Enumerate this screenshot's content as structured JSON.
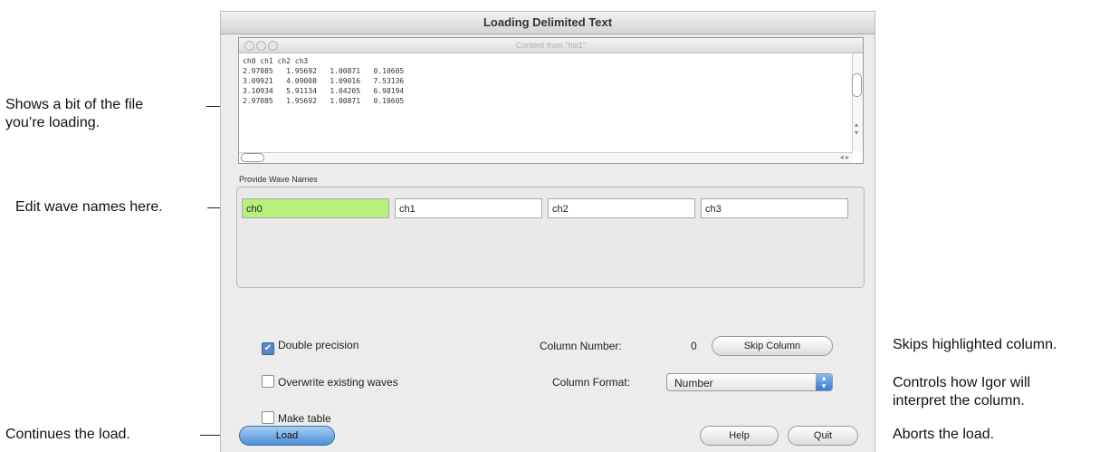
{
  "dialog": {
    "title": "Loading Delimited Text",
    "preview_title": "Content from \"hsi1\"",
    "preview_lines": [
      "ch0 ch1 ch2 ch3",
      "2.97085   1.95692   1.00871   0.10605",
      "3.09921   4.09008   1.09016   7.53136",
      "3.10934   5.91134   1.04205   6.98194",
      "2.97085   1.95692   1.00871   0.10605"
    ],
    "wave_group_label": "Provide Wave Names",
    "wave_names": [
      "ch0",
      "ch1",
      "ch2",
      "ch3"
    ],
    "double_precision": {
      "label": "Double precision",
      "checked": true
    },
    "overwrite": {
      "label": "Overwrite existing waves",
      "checked": false
    },
    "make_table": {
      "label": "Make table",
      "checked": false
    },
    "column_number_label": "Column Number:",
    "column_number_value": "0",
    "skip_column_label": "Skip Column",
    "column_format_label": "Column Format:",
    "column_format_value": "Number",
    "load_label": "Load",
    "help_label": "Help",
    "quit_label": "Quit"
  },
  "callouts": {
    "preview": [
      "Shows a bit of the file",
      "you’re loading."
    ],
    "wave_names": "Edit wave names here.",
    "skip": "Skips highlighted column.",
    "format": [
      "Controls how Igor will",
      "interpret the column."
    ],
    "load": "Continues the load.",
    "quit": "Aborts the load."
  }
}
